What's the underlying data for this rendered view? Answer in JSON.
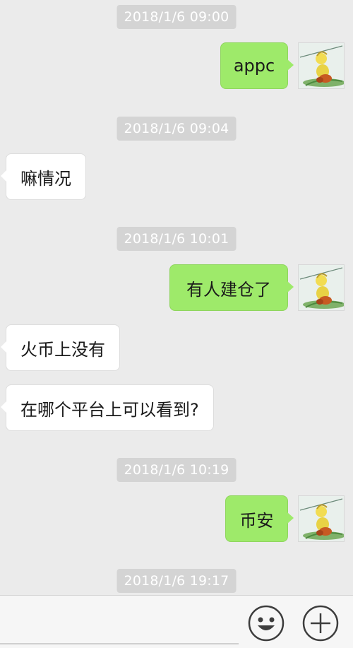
{
  "messages": [
    {
      "type": "timestamp",
      "text": "2018/1/6 09:00"
    },
    {
      "type": "outgoing",
      "text": "appc",
      "avatar": "cartoon-avatar-icon"
    },
    {
      "type": "timestamp",
      "text": "2018/1/6 09:04"
    },
    {
      "type": "incoming",
      "text": "嘛情况"
    },
    {
      "type": "timestamp",
      "text": "2018/1/6 10:01"
    },
    {
      "type": "outgoing",
      "text": "有人建仓了",
      "avatar": "cartoon-avatar-icon"
    },
    {
      "type": "incoming",
      "text": "火币上没有"
    },
    {
      "type": "incoming",
      "text": "在哪个平台上可以看到?"
    },
    {
      "type": "timestamp",
      "text": "2018/1/6 10:19"
    },
    {
      "type": "outgoing",
      "text": "币安",
      "avatar": "cartoon-avatar-icon"
    },
    {
      "type": "timestamp",
      "text": "2018/1/6 19:17"
    }
  ],
  "input_bar": {
    "emoji_button_icon": "smiley-icon",
    "more_button_icon": "plus-icon"
  },
  "colors": {
    "background": "#ebebeb",
    "outgoing_bubble": "#9eea6a",
    "incoming_bubble": "#ffffff",
    "timestamp_bg": "#d4d4d4"
  }
}
